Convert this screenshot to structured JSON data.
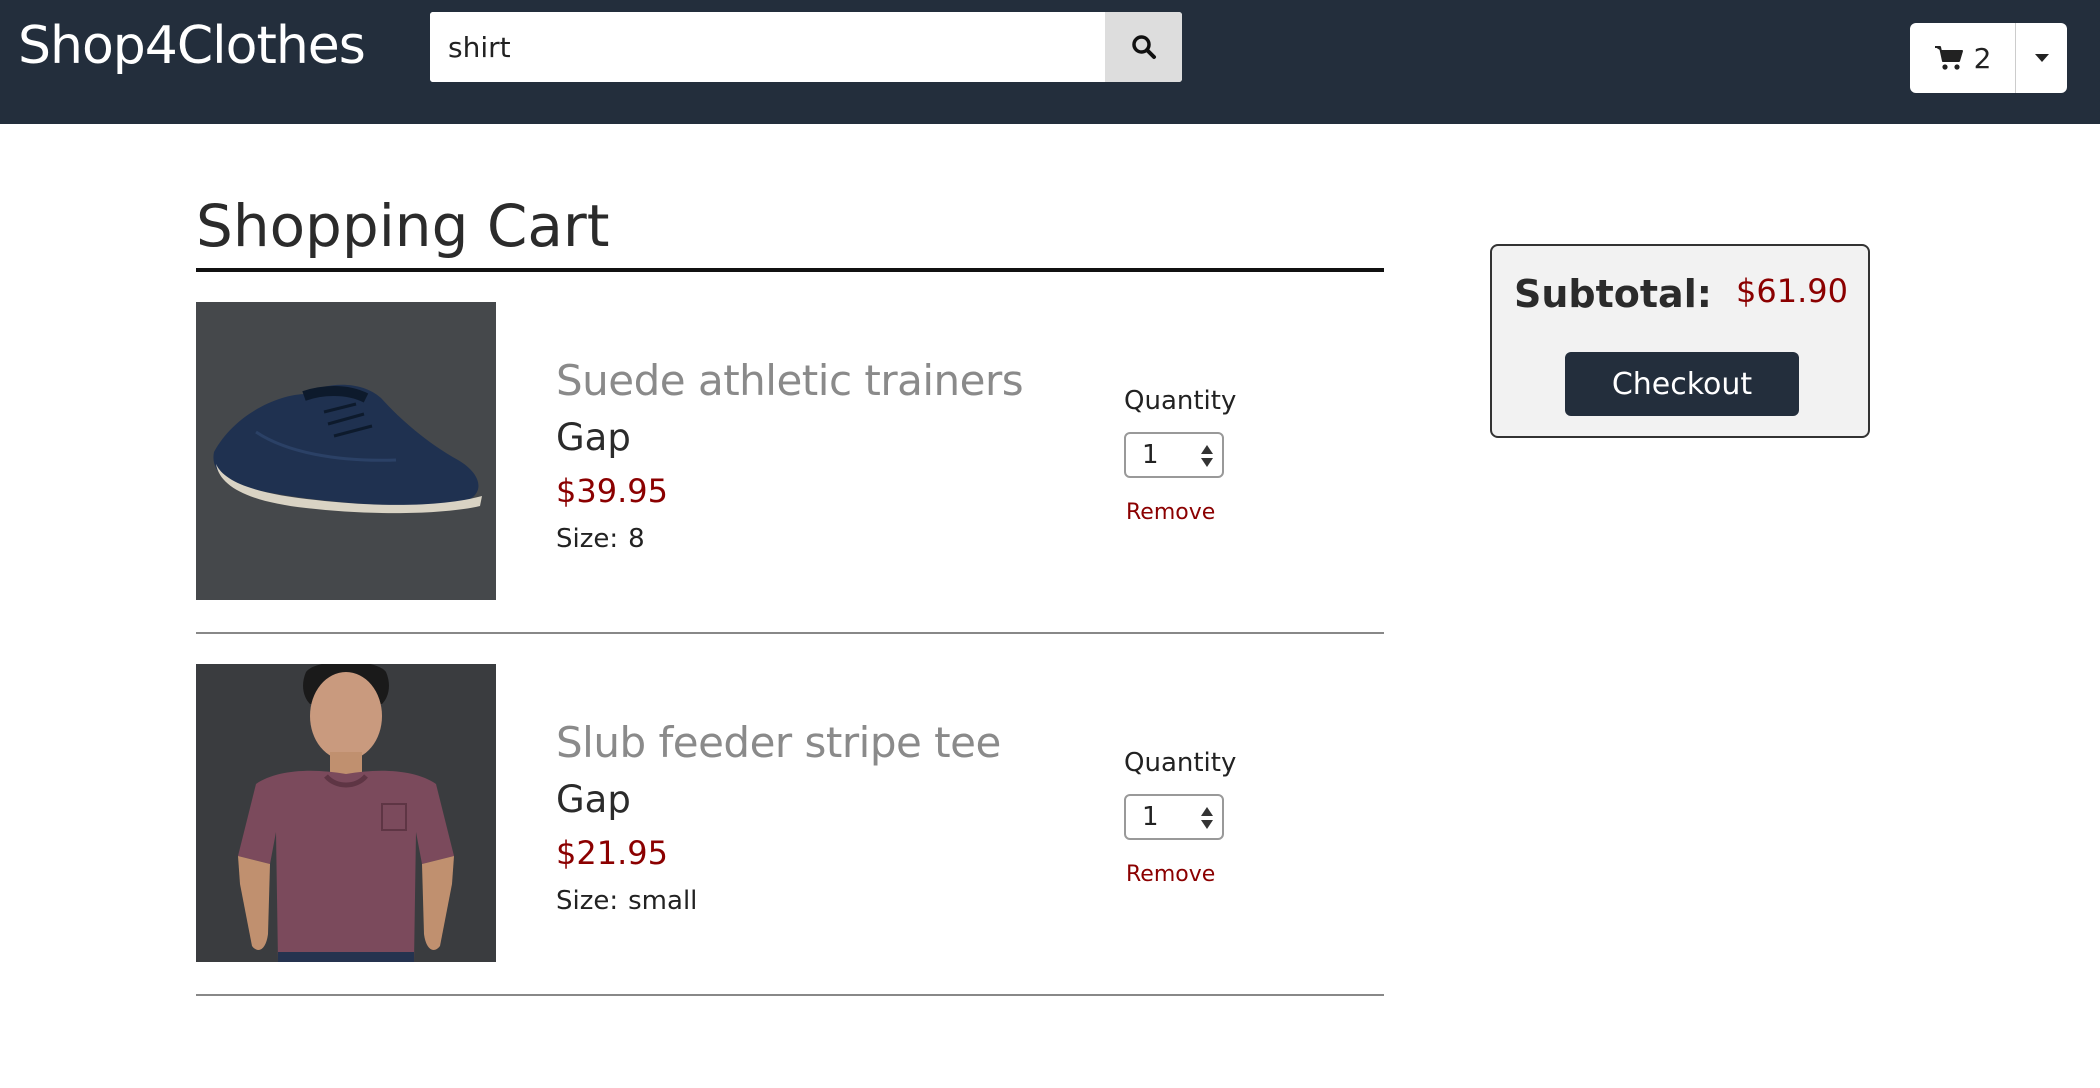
{
  "header": {
    "brand": "Shop4Clothes",
    "search": {
      "value": "shirt",
      "icon": "search-icon"
    },
    "cart": {
      "count": "2",
      "icon": "shopping-cart-icon",
      "menu_icon": "caret-down-icon"
    }
  },
  "cart_page": {
    "title": "Shopping Cart",
    "items": [
      {
        "name": "Suede athletic trainers",
        "brand": "Gap",
        "price": "$39.95",
        "size_label": "Size:",
        "size": "8",
        "quantity_label": "Quantity",
        "quantity": "1",
        "remove_label": "Remove",
        "image": "navy-suede-sneaker"
      },
      {
        "name": "Slub feeder stripe tee",
        "brand": "Gap",
        "price": "$21.95",
        "size_label": "Size:",
        "size": "small",
        "quantity_label": "Quantity",
        "quantity": "1",
        "remove_label": "Remove",
        "image": "man-in-maroon-tee"
      }
    ]
  },
  "summary": {
    "subtotal_label": "Subtotal:",
    "subtotal_value": "$61.90",
    "checkout_label": "Checkout"
  },
  "colors": {
    "header_bg": "#232e3c",
    "price": "#8b0000",
    "product_name": "#8a8a8a",
    "summary_bg": "#f2f2f2"
  }
}
